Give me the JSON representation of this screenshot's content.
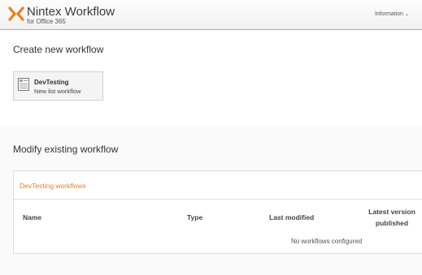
{
  "header": {
    "logo_title": "Nintex Workflow",
    "logo_subtitle": "for Office 365",
    "info_menu": "Information"
  },
  "create": {
    "title": "Create new workflow",
    "tile": {
      "name": "DevTesting",
      "subtitle": "New list workflow"
    }
  },
  "modify": {
    "title": "Modify existing workflow",
    "panel_title": "DevTesting workflows",
    "columns": {
      "name": "Name",
      "type": "Type",
      "last_modified": "Last modified",
      "latest_version": "Latest version published"
    },
    "empty_message": "No workflows configured"
  },
  "colors": {
    "accent": "#f07d1a",
    "header_border": "#f39c45"
  }
}
